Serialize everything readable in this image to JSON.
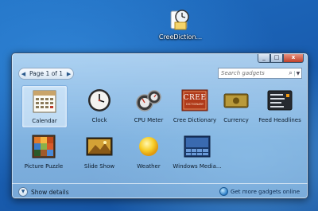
{
  "desktop": {
    "file_label": "CreeDiction..."
  },
  "window": {
    "controls": [
      "_",
      "□",
      "x"
    ],
    "pager": {
      "prev_icon": "chevron-left-icon",
      "text": "Page 1 of 1",
      "next_icon": "chevron-right-icon"
    },
    "search": {
      "placeholder": "Search gadgets",
      "icon": "search-icon"
    },
    "gadgets": [
      {
        "id": "calendar",
        "label": "Calendar",
        "selected": true
      },
      {
        "id": "clock",
        "label": "Clock"
      },
      {
        "id": "cpu-meter",
        "label": "CPU Meter"
      },
      {
        "id": "cree-dictionary",
        "label": "Cree Dictionary",
        "logo_text": "CREE",
        "logo_sub": "DICTIONARY"
      },
      {
        "id": "currency",
        "label": "Currency"
      },
      {
        "id": "feed-headlines",
        "label": "Feed Headlines"
      },
      {
        "id": "picture-puzzle",
        "label": "Picture Puzzle"
      },
      {
        "id": "slide-show",
        "label": "Slide Show"
      },
      {
        "id": "weather",
        "label": "Weather"
      },
      {
        "id": "windows-media",
        "label": "Windows Media..."
      }
    ],
    "footer": {
      "details_label": "Show details",
      "online_label": "Get more gadgets online"
    }
  }
}
